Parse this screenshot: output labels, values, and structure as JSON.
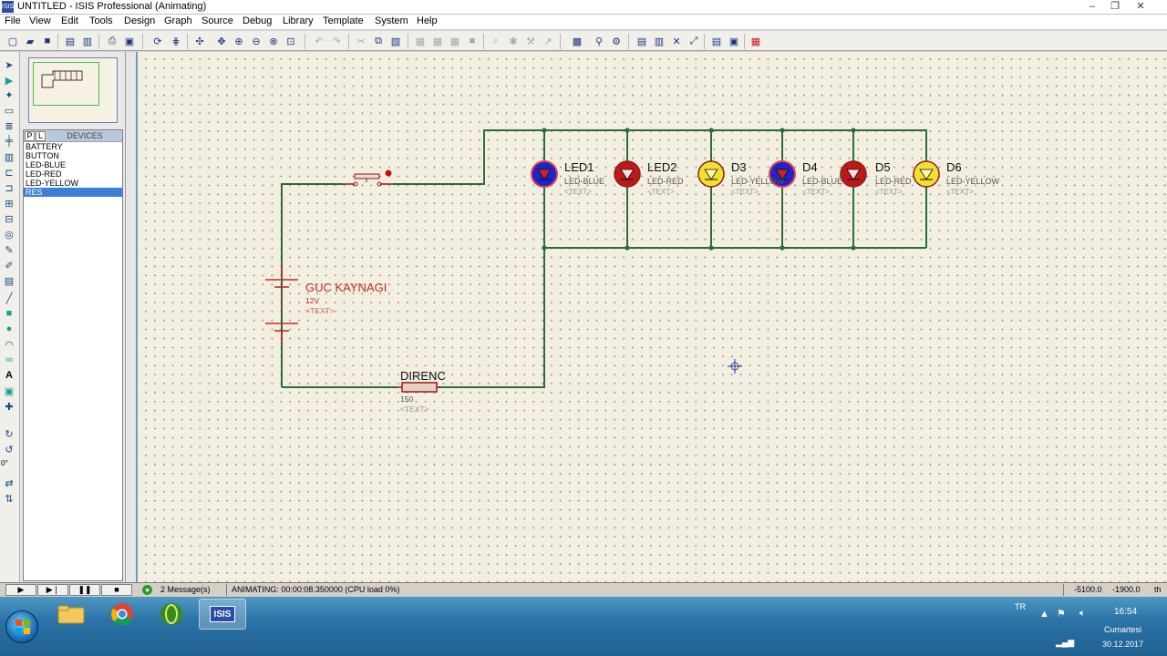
{
  "window": {
    "title": "UNTITLED - ISIS Professional (Animating)",
    "app_icon": "ISIS"
  },
  "menu": [
    "File",
    "View",
    "Edit",
    "Tools",
    "Design",
    "Graph",
    "Source",
    "Debug",
    "Library",
    "Template",
    "System",
    "Help"
  ],
  "device_panel": {
    "tab_p": "P",
    "tab_l": "L",
    "header": "DEVICES",
    "items": [
      "BATTERY",
      "BUTTON",
      "LED-BLUE",
      "LED-RED",
      "LED-YELLOW",
      "RES"
    ],
    "selected": "RES"
  },
  "left_tools": {
    "angle": "0°"
  },
  "schematic": {
    "battery": {
      "name": "GUC KAYNAGI",
      "value": "12V",
      "text": "<TEXT>"
    },
    "resistor": {
      "name": "DIRENC",
      "value": "150",
      "text": "<TEXT>"
    },
    "leds": [
      {
        "name": "LED1",
        "type": "LED-BLUE",
        "text": "<TEXT>",
        "color": "#2222cc"
      },
      {
        "name": "LED2",
        "type": "LED-RED",
        "text": "<TEXT>",
        "color": "#c01818"
      },
      {
        "name": "D3",
        "type": "LED-YELLOW",
        "text": "<TEXT>",
        "color": "#f2e030"
      },
      {
        "name": "D4",
        "type": "LED-BLUE",
        "text": "<TEXT>",
        "color": "#2222cc"
      },
      {
        "name": "D5",
        "type": "LED-RED",
        "text": "<TEXT>",
        "color": "#c01818"
      },
      {
        "name": "D6",
        "type": "LED-YELLOW",
        "text": "<TEXT>",
        "color": "#f2e030"
      }
    ],
    "wire_color": "#2e6b3a",
    "component_color": "#8b1e1e"
  },
  "statusbar": {
    "messages": "2 Message(s)",
    "status": "ANIMATING: 00:00:08.350000 (CPU load 0%)",
    "coord_x": "-5100.0",
    "coord_y": "-1900.0",
    "units": "th"
  },
  "taskbar": {
    "lang": "TR",
    "time": "16:54",
    "day": "Cumartesi",
    "date": "30.12.2017",
    "active_app": "ISIS"
  }
}
